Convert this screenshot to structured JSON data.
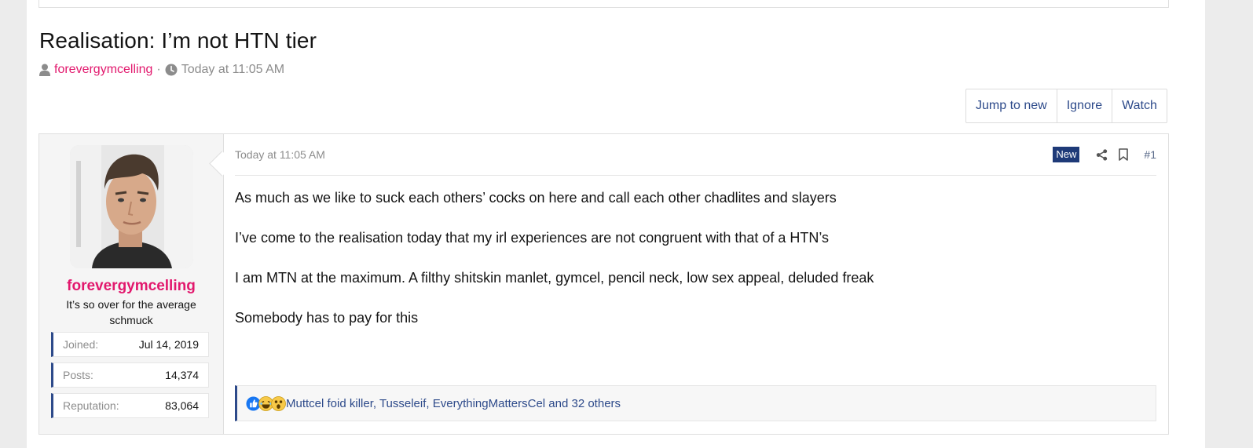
{
  "thread": {
    "title": "Realisation: I’m not HTN tier",
    "author": "forevergymcelling",
    "separator": "·",
    "date": "Today at 11:05 AM"
  },
  "actions": {
    "jump_to_new": "Jump to new",
    "ignore": "Ignore",
    "watch": "Watch"
  },
  "post": {
    "date": "Today at 11:05 AM",
    "badge": "New",
    "number": "#1",
    "paragraphs": [
      "As much as we like to suck each others’ cocks on here and call each other chadlites and slayers",
      "I’ve come to the realisation today that my irl experiences are not congruent with that of a HTN’s",
      "I am MTN at the maximum. A filthy shitskin manlet, gymcel, pencil neck, low sex appeal, deluded freak",
      "Somebody has to pay for this"
    ],
    "reactions": {
      "icons": [
        "like-icon",
        "laugh-icon",
        "shocked-icon"
      ],
      "text": "Muttcel foid killer, Tusseleif, EverythingMattersCel and 32 others"
    }
  },
  "user": {
    "name": "forevergymcelling",
    "title": "It’s so over for the average schmuck",
    "stats": [
      {
        "label": "Joined:",
        "value": "Jul 14, 2019"
      },
      {
        "label": "Posts:",
        "value": "14,374"
      },
      {
        "label": "Reputation:",
        "value": "83,064"
      }
    ]
  },
  "colors": {
    "accent_pink": "#e2186d",
    "link_blue": "#2d4a8a",
    "badge_navy": "#1e3a78"
  }
}
